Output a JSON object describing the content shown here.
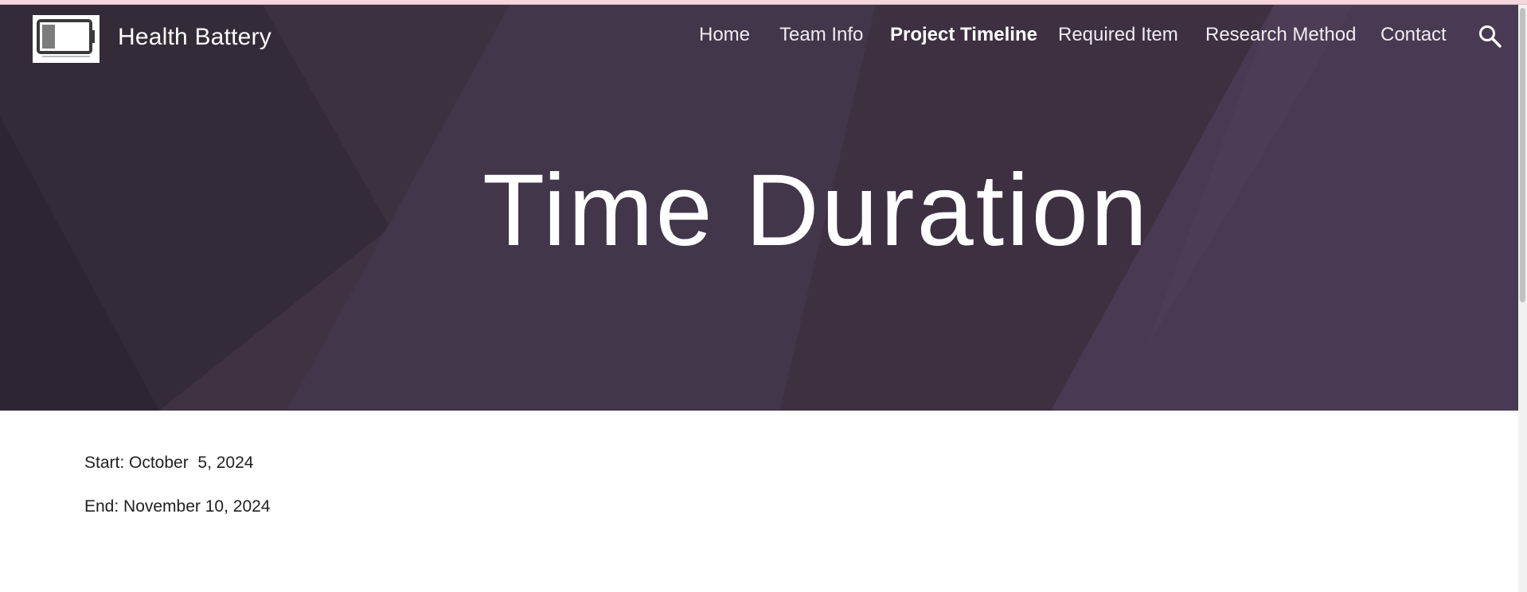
{
  "site": {
    "title": "Health Battery",
    "logo_icon": "battery-low-icon"
  },
  "nav": {
    "items": [
      {
        "label": "Home",
        "active": false
      },
      {
        "label": "Team Info",
        "active": false
      },
      {
        "label": "Project Timeline",
        "active": true
      },
      {
        "label": "Required Item",
        "active": false
      },
      {
        "label": "Research Method",
        "active": false
      },
      {
        "label": "Contact",
        "active": false
      }
    ],
    "search_icon": "search-icon"
  },
  "hero": {
    "title": "Time Duration"
  },
  "content": {
    "start": "Start: October  5, 2024",
    "end": "End: November 10, 2024"
  },
  "colors": {
    "hero_base": "#3f3343",
    "hero_dark": "#2e2531",
    "hero_light": "#4a3a50",
    "top_strip": "#f6d6dd",
    "text": "#212121"
  }
}
